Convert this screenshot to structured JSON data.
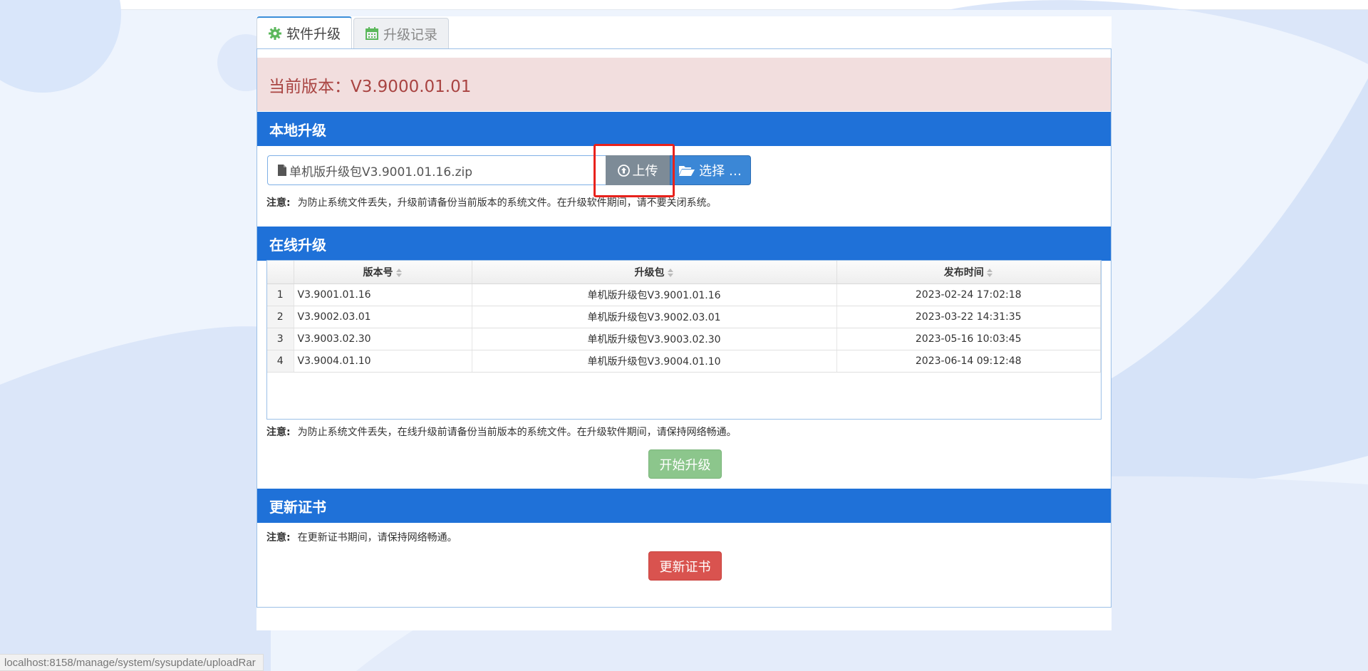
{
  "tabs": [
    {
      "label": "软件升级",
      "icon": "gear-icon",
      "active": true
    },
    {
      "label": "升级记录",
      "icon": "calendar-icon",
      "active": false
    }
  ],
  "version": {
    "text": "当前版本：V3.9000.01.01"
  },
  "local_upgrade": {
    "title": "本地升级",
    "file_value": "单机版升级包V3.9001.01.16.zip",
    "upload_label": "上传",
    "select_label": "选择 …",
    "notice_label": "注意:",
    "notice_text": "为防止系统文件丢失，升级前请备份当前版本的系统文件。在升级软件期间，请不要关闭系统。"
  },
  "online_upgrade": {
    "title": "在线升级",
    "columns": [
      "版本号",
      "升级包",
      "发布时间"
    ],
    "rows": [
      {
        "n": "1",
        "version": "V3.9001.01.16",
        "package": "单机版升级包V3.9001.01.16",
        "time": "2023-02-24 17:02:18"
      },
      {
        "n": "2",
        "version": "V3.9002.03.01",
        "package": "单机版升级包V3.9002.03.01",
        "time": "2023-03-22 14:31:35"
      },
      {
        "n": "3",
        "version": "V3.9003.02.30",
        "package": "单机版升级包V3.9003.02.30",
        "time": "2023-05-16 10:03:45"
      },
      {
        "n": "4",
        "version": "V3.9004.01.10",
        "package": "单机版升级包V3.9004.01.10",
        "time": "2023-06-14 09:12:48"
      }
    ],
    "notice_label": "注意:",
    "notice_text": "为防止系统文件丢失，在线升级前请备份当前版本的系统文件。在升级软件期间，请保持网络畅通。",
    "start_label": "开始升级"
  },
  "certificate": {
    "title": "更新证书",
    "notice_label": "注意:",
    "notice_text": "在更新证书期间，请保持网络畅通。",
    "button_label": "更新证书"
  },
  "status_bar": {
    "url": "localhost:8158/manage/system/sysupdate/uploadRar"
  },
  "colors": {
    "section_header": "#1f71d8",
    "version_bg": "#f2dede",
    "version_text": "#a94442",
    "start_button": "#8cc68c",
    "cert_button": "#d9534f",
    "highlight_box": "#e8221c"
  }
}
